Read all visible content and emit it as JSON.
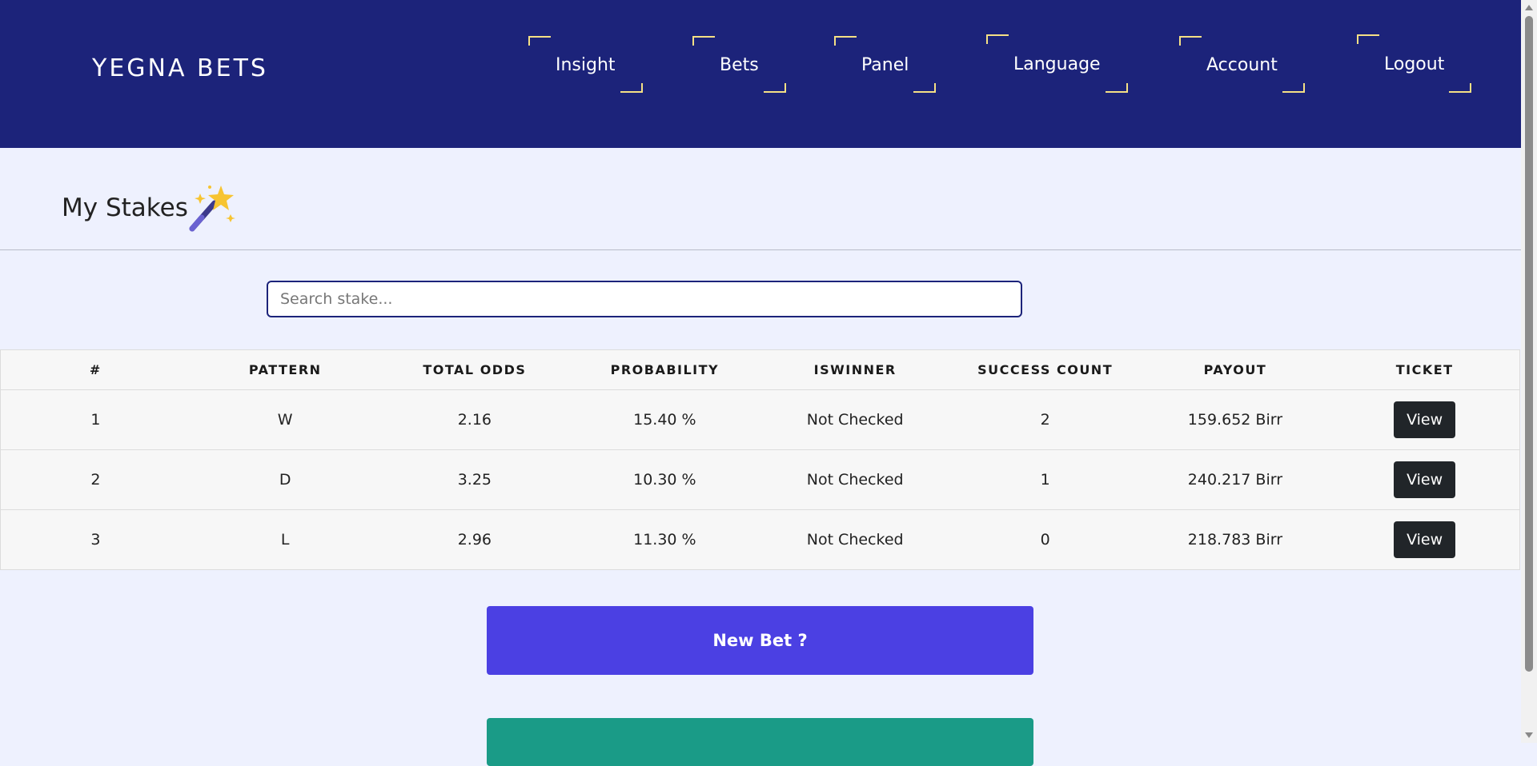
{
  "header": {
    "brand": "YEGNA BETS",
    "nav": [
      "Insight",
      "Bets",
      "Panel",
      "Language",
      "Account",
      "Logout"
    ]
  },
  "page": {
    "title": "My Stakes",
    "title_icon": "magic-wand-icon"
  },
  "search": {
    "placeholder": "Search stake..."
  },
  "table": {
    "columns": [
      "#",
      "PATTERN",
      "TOTAL ODDS",
      "PROBABILITY",
      "ISWINNER",
      "SUCCESS COUNT",
      "PAYOUT",
      "TICKET"
    ],
    "rows": [
      {
        "num": "1",
        "pattern": "W",
        "odds": "2.16",
        "probability": "15.40 %",
        "iswinner": "Not Checked",
        "success": "2",
        "payout": "159.652 Birr",
        "ticket": "View"
      },
      {
        "num": "2",
        "pattern": "D",
        "odds": "3.25",
        "probability": "10.30 %",
        "iswinner": "Not Checked",
        "success": "1",
        "payout": "240.217 Birr",
        "ticket": "View"
      },
      {
        "num": "3",
        "pattern": "L",
        "odds": "2.96",
        "probability": "11.30 %",
        "iswinner": "Not Checked",
        "success": "0",
        "payout": "218.783 Birr",
        "ticket": "View"
      }
    ]
  },
  "actions": {
    "new_bet": "New Bet ?"
  },
  "colors": {
    "header_bg": "#1c237a",
    "page_bg": "#eef1fe",
    "accent_yellow": "#f5e085",
    "new_bet_bg": "#4b40e3",
    "secondary_bg": "#1a9b87",
    "view_btn_bg": "#212529"
  }
}
